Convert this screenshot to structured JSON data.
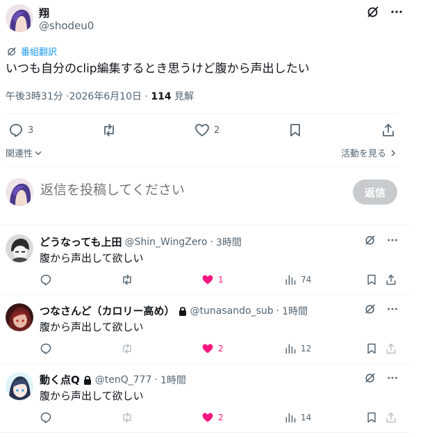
{
  "post": {
    "author_name": "翔",
    "author_handle": "@shodeu0",
    "translate_label": "番組翻訳",
    "text": "いつも自分のclip編集するとき思うけど腹から声出したい",
    "time": "午後3時31分",
    "date": "2026年6月10日",
    "sep1": "·",
    "sep2": "·",
    "views_count": "114",
    "views_label": "見解",
    "reply_count": "3",
    "like_count": "2",
    "relevance_label": "関連性",
    "activity_label": "活動を見る"
  },
  "compose": {
    "placeholder": "返信を投稿してください",
    "button_label": "返信"
  },
  "replies": [
    {
      "name": "どうなっても上田",
      "handle": "@Shin_WingZero",
      "sep": "·",
      "time": "3時間",
      "text": "腹から声出して欲しい",
      "likes": "1",
      "views": "74",
      "locked": false,
      "liked": true
    },
    {
      "name": "つなさんど（カロリー高め）",
      "handle": "@tunasando_sub",
      "sep": "·",
      "time": "1時間",
      "text": "腹から声出して欲しい",
      "likes": "2",
      "views": "12",
      "locked": true,
      "liked": true
    },
    {
      "name": "動く点Q",
      "handle": "@tenQ_777",
      "sep": "·",
      "time": "1時間",
      "text": "腹から声出して欲しい",
      "likes": "2",
      "views": "14",
      "locked": true,
      "liked": true
    }
  ],
  "colors": {
    "accent": "#1d9bf0",
    "like": "#f91880",
    "muted": "#536471",
    "text": "#0f1419",
    "divider": "#eff3f4",
    "button_disabled": "#c8cbcd"
  }
}
